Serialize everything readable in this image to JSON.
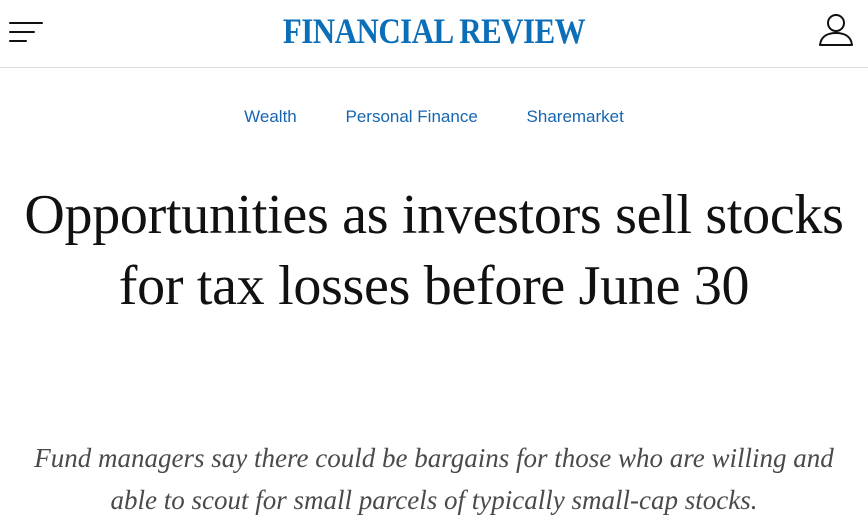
{
  "header": {
    "logo_text": "FINANCIAL REVIEW",
    "menu_icon": "hamburger-menu-icon",
    "account_icon": "user-account-icon",
    "brand_color": "#0a6eb8"
  },
  "breadcrumbs": [
    {
      "label": "Wealth"
    },
    {
      "label": "Personal Finance"
    },
    {
      "label": "Sharemarket"
    }
  ],
  "article": {
    "headline": "Opportunities as investors sell stocks for tax losses before June 30",
    "standfirst": "Fund managers say there could be bargains for those who are willing and able to scout for small parcels of typically small-cap stocks."
  }
}
